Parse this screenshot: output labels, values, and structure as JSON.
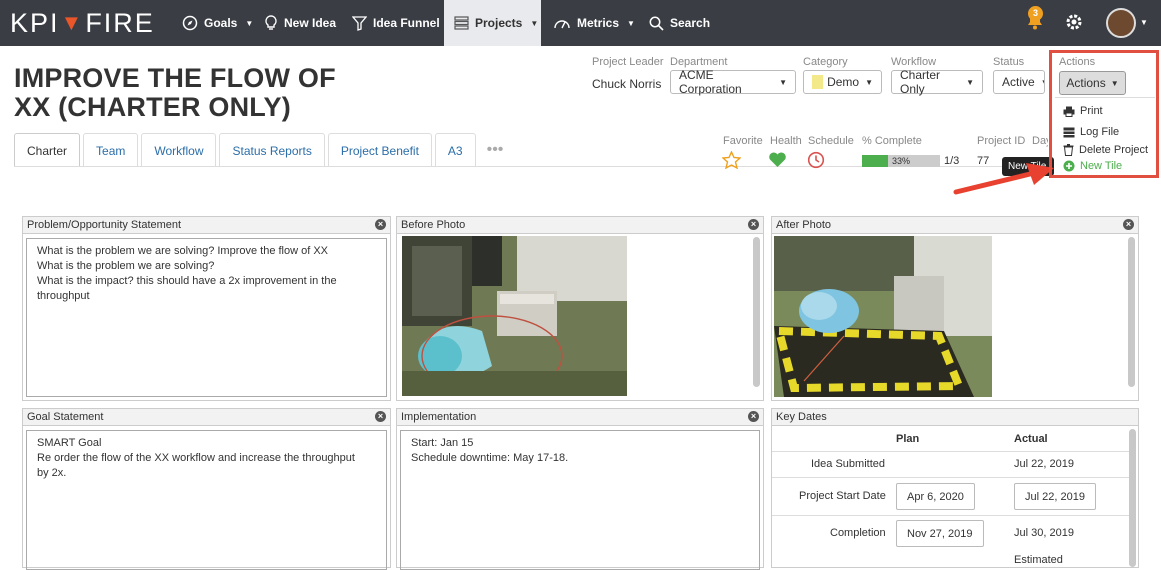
{
  "nav": {
    "logo_left": "KPI",
    "logo_right": "FIRE",
    "goals": "Goals",
    "new_idea": "New Idea",
    "idea_funnel": "Idea Funnel",
    "projects": "Projects",
    "metrics": "Metrics",
    "search": "Search",
    "notifications": "3"
  },
  "project": {
    "title_line1": "IMPROVE THE FLOW OF",
    "title_line2": "XX (CHARTER ONLY)",
    "leader_label": "Project Leader",
    "leader": "Chuck Norris",
    "department_label": "Department",
    "department": "ACME Corporation",
    "category_label": "Category",
    "category": "Demo",
    "workflow_label": "Workflow",
    "workflow": "Charter Only",
    "status_label": "Status",
    "status": "Active",
    "actions_label": "Actions",
    "actions_button": "Actions"
  },
  "colors": {
    "accent": "#e8562a",
    "topbar": "#3a3e44",
    "highlight": "#e04f3f",
    "health_green": "#4cae4c",
    "schedule_red": "#d9534f",
    "favorite_orange": "#f0a020"
  },
  "tabs": [
    "Charter",
    "Team",
    "Workflow",
    "Status Reports",
    "Project Benefit",
    "A3"
  ],
  "stats": {
    "favorite_label": "Favorite",
    "health_label": "Health",
    "schedule_label": "Schedule",
    "complete_label": "% Complete",
    "complete_percent": "33%",
    "complete_fraction": 0.33,
    "steps": "1/3",
    "project_id_label": "Project ID",
    "project_id": "77",
    "days_label": "Day",
    "tooltip": "New Tile"
  },
  "actions_menu": {
    "print": "Print",
    "log_file": "Log File",
    "delete_project": "Delete Project",
    "new_tile": "New Tile"
  },
  "panels": {
    "problem": {
      "title": "Problem/Opportunity Statement",
      "line1": "What is the problem we are solving? Improve the flow of XX",
      "line2": "What is the problem we are solving?",
      "line3": "What is the impact? this should have a 2x improvement in the",
      "line4": "throughput"
    },
    "before_photo": {
      "title": "Before Photo"
    },
    "after_photo": {
      "title": "After Photo"
    },
    "goal": {
      "title": "Goal Statement",
      "line1": "SMART Goal",
      "line2": "Re order the flow of the XX workflow and increase the throughput",
      "line3": "by 2x."
    },
    "implementation": {
      "title": "Implementation",
      "line1": "Start:  Jan 15",
      "line2": "Schedule downtime:  May 17-18."
    },
    "key_dates": {
      "title": "Key Dates",
      "plan_header": "Plan",
      "actual_header": "Actual",
      "rows": [
        {
          "label": "Idea Submitted",
          "plan": "",
          "actual": "Jul 22, 2019"
        },
        {
          "label": "Project Start Date",
          "plan": "Apr 6, 2020",
          "actual": "Jul 22, 2019"
        },
        {
          "label": "Completion",
          "plan": "Nov 27, 2019",
          "actual": "Jul 30, 2019"
        }
      ],
      "estimated": "Estimated"
    }
  }
}
